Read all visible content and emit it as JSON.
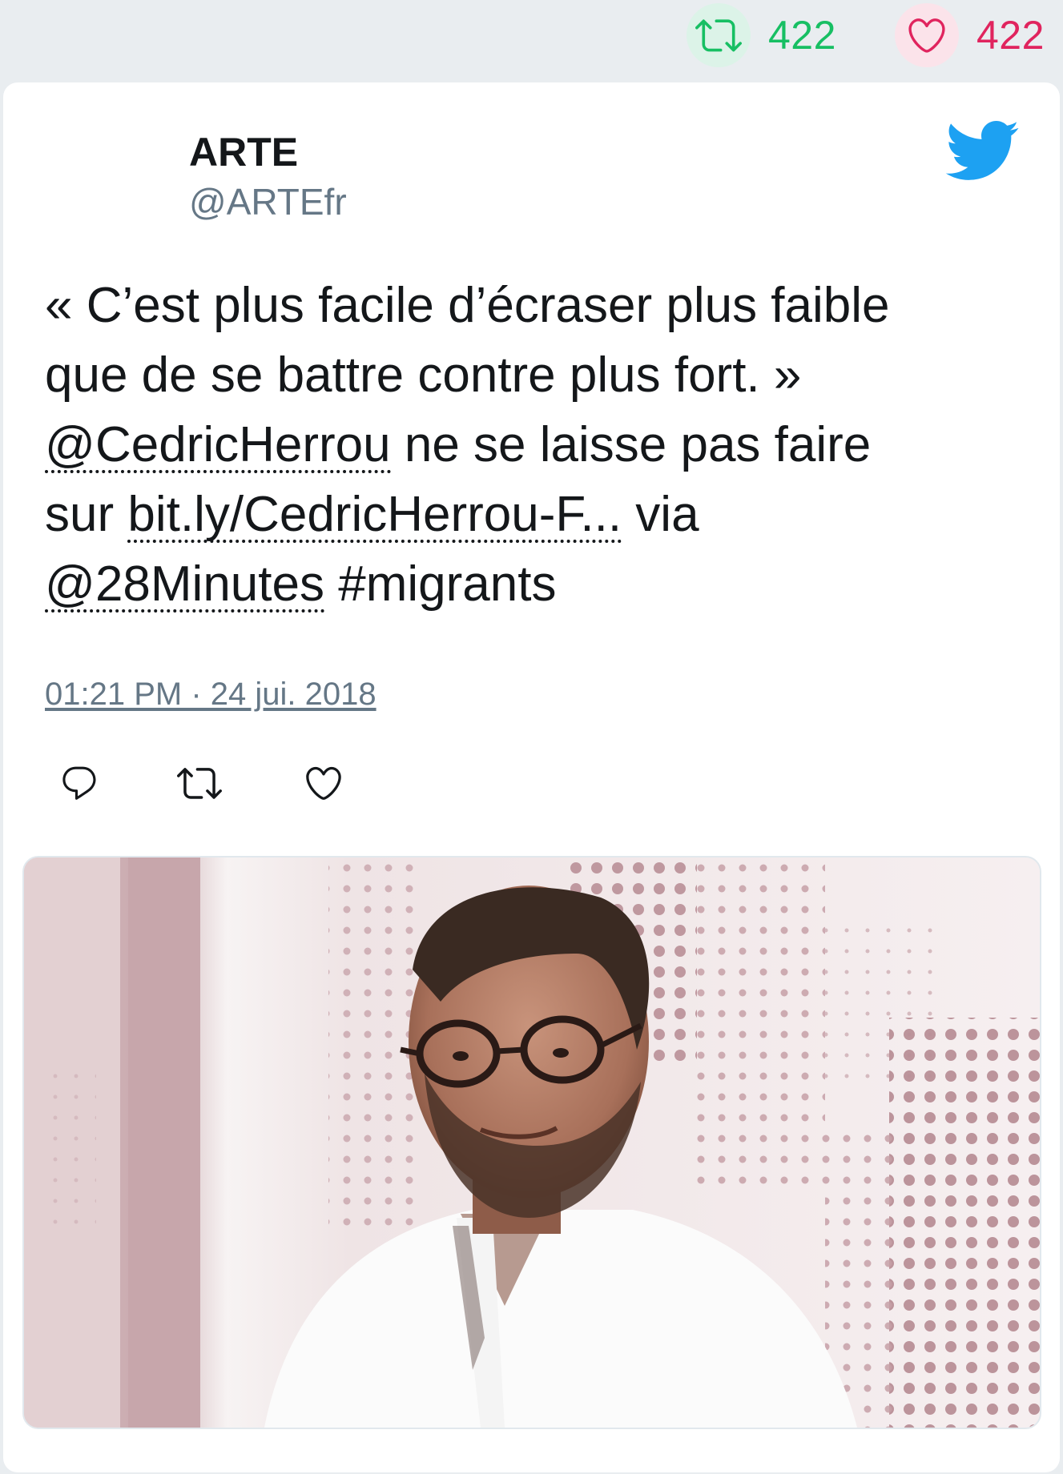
{
  "stats": {
    "retweet_count": "422",
    "like_count": "422"
  },
  "author": {
    "name": "ARTE",
    "handle": "@ARTEfr"
  },
  "tweet": {
    "line1": "« C’est plus facile d’écraser plus faible",
    "line2": "que de se battre contre plus fort. »",
    "mention1": "@CedricHerrou",
    "line3_rest": " ne se laisse pas faire",
    "line4_start": "sur ",
    "link": "bit.ly/CedricHerrou-F...",
    "line4_rest": " via",
    "mention2": "@28Minutes",
    "hashtag": " #migrants"
  },
  "timestamp": "01:21 PM · 24 jui. 2018",
  "icons": {
    "retweet": "retweet-icon",
    "like": "heart-icon",
    "reply": "reply-icon",
    "brand": "twitter-bird-icon"
  },
  "colors": {
    "retweet_green": "#17bf63",
    "like_red": "#e0245e",
    "twitter_blue": "#1da1f2",
    "text_gray": "#657786"
  }
}
